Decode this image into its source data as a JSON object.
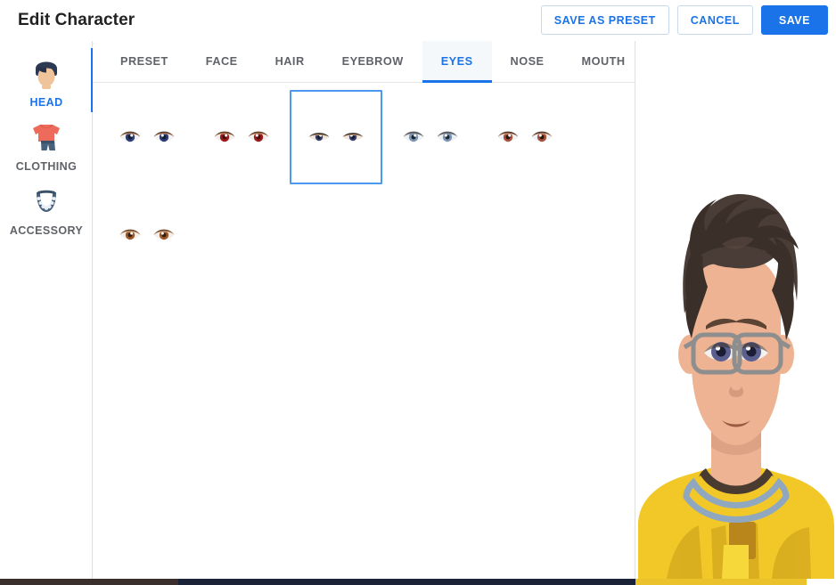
{
  "header": {
    "title": "Edit Character",
    "buttons": [
      {
        "label": "SAVE AS PRESET",
        "style": "outline",
        "name": "save-as-preset-button"
      },
      {
        "label": "CANCEL",
        "style": "outline",
        "name": "cancel-button"
      },
      {
        "label": "SAVE",
        "style": "primary",
        "name": "save-button"
      }
    ]
  },
  "sidebar": {
    "items": [
      {
        "label": "HEAD",
        "icon": "head-icon",
        "active": true
      },
      {
        "label": "CLOTHING",
        "icon": "clothing-icon",
        "active": false
      },
      {
        "label": "ACCESSORY",
        "icon": "accessory-icon",
        "active": false
      }
    ]
  },
  "tabs": [
    {
      "label": "PRESET",
      "active": false
    },
    {
      "label": "FACE",
      "active": false
    },
    {
      "label": "HAIR",
      "active": false
    },
    {
      "label": "EYEBROW",
      "active": false
    },
    {
      "label": "EYES",
      "active": true
    },
    {
      "label": "NOSE",
      "active": false
    },
    {
      "label": "MOUTH",
      "active": false
    }
  ],
  "options": {
    "category": "EYES",
    "selected_index": 2,
    "items": [
      {
        "name": "eyes-option-navy",
        "iris": "#2d3f78",
        "pupil": "#141c33",
        "sclera": "#f2f2f4",
        "lid": "#d99a77",
        "lash": "#3f3020",
        "shape": "round"
      },
      {
        "name": "eyes-option-red",
        "iris": "#9b1b1b",
        "pupil": "#4a0c0c",
        "sclera": "#f3efef",
        "lid": "#e0a884",
        "lash": "#4a2a18",
        "shape": "round"
      },
      {
        "name": "eyes-option-deep-blue",
        "iris": "#3a3f6e",
        "pupil": "#15182c",
        "sclera": "#efe7dd",
        "lid": "#c8a184",
        "lash": "#2b2419",
        "shape": "narrow"
      },
      {
        "name": "eyes-option-steel-blue",
        "iris": "#7b96b4",
        "pupil": "#1b2430",
        "sclera": "#eef1f4",
        "lid": "#8a8f93",
        "lash": "#4b4f54",
        "shape": "round"
      },
      {
        "name": "eyes-option-rust",
        "iris": "#a8523c",
        "pupil": "#2a1410",
        "sclera": "#eef2f6",
        "lid": "#e4b094",
        "lash": "#3a2418",
        "shape": "round"
      },
      {
        "name": "eyes-option-brown",
        "iris": "#9a5a2c",
        "pupil": "#3a1d0c",
        "sclera": "#f6efe8",
        "lid": "#e3bb98",
        "lash": "#5a3418",
        "shape": "round"
      }
    ]
  },
  "preview": {
    "name": "character-preview",
    "colors": {
      "skin": "#edb392",
      "skin_shadow": "#dda183",
      "hair": "#4a3c36",
      "hair_dark": "#3b2f2a",
      "hair_light": "#5a4a42",
      "eyebrow": "#5c4334",
      "iris": "#5a5f8f",
      "pupil": "#1a1d33",
      "sclera": "#f4f1ee",
      "glasses_frame": "#8e8e8e",
      "shirt": "#f2c829",
      "shirt_shadow": "#d9ae1f",
      "collar_inner": "#4a3b31",
      "collar_ring": "#8fa8bf",
      "mouth": "#9b5b40",
      "nose_shadow": "#d79a7c"
    }
  },
  "accents": {
    "primary_blue": "#1a73e8",
    "selection_border": "#4a9bf0",
    "active_tab_bg": "#f5f8fb",
    "divider": "#e0e0e0",
    "text_muted": "#5f6368",
    "text_dark": "#222222"
  }
}
